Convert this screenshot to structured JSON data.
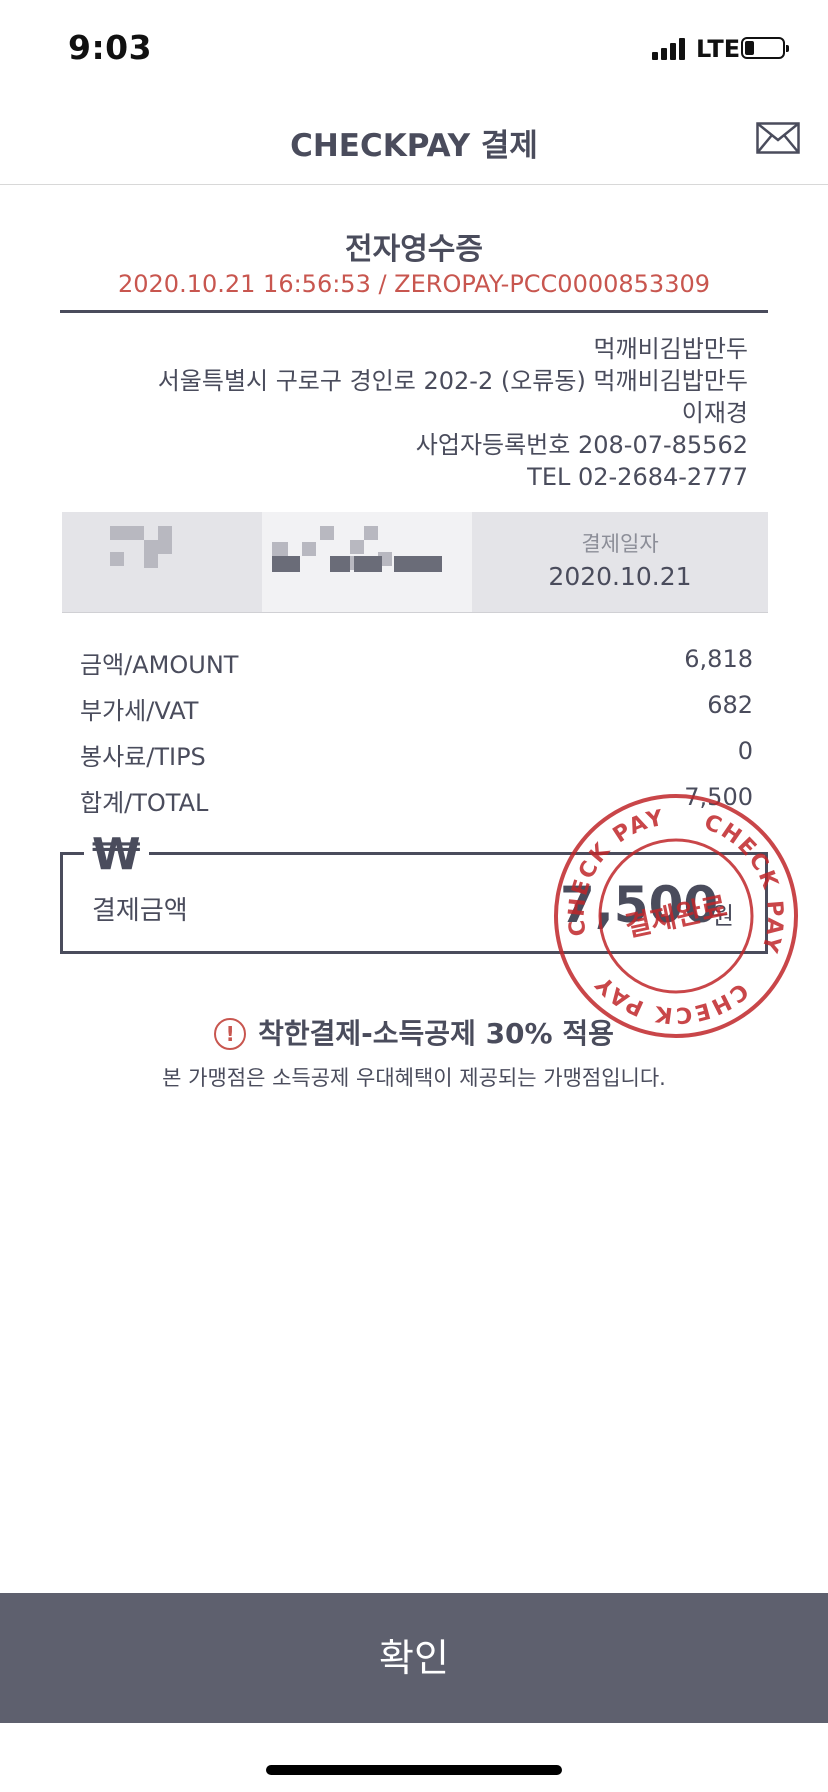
{
  "status_bar": {
    "time": "9:03",
    "network": "LTE",
    "battery_level": 0.25
  },
  "header": {
    "title": "CHECKPAY 결제",
    "mail_icon": "mail-icon"
  },
  "receipt": {
    "title": "전자영수증",
    "meta": "2020.10.21 16:56:53 / ZEROPAY-PCC0000853309"
  },
  "merchant": {
    "name": "먹깨비김밥만두",
    "address": "서울특별시 구로구 경인로 202-2 (오류동) 먹깨비김밥만두",
    "owner": "이재경",
    "business_no": "사업자등록번호 208-07-85562",
    "tel": "TEL 02-2684-2777"
  },
  "payment_date": {
    "label": "결제일자",
    "value": "2020.10.21"
  },
  "amounts": [
    {
      "label": "금액/AMOUNT",
      "value": "6,818"
    },
    {
      "label": "부가세/VAT",
      "value": "682"
    },
    {
      "label": "봉사료/TIPS",
      "value": "0"
    },
    {
      "label": "합계/TOTAL",
      "value": "7,500"
    }
  ],
  "total": {
    "symbol": "₩",
    "label": "결제금액",
    "amount": "7,500",
    "unit": "원"
  },
  "stamp": {
    "ring_text": "CHECK PAY",
    "center_text": "결제완료",
    "color": "#c0262a"
  },
  "notice": {
    "icon": "!",
    "title": "착한결제-소득공제 30% 적용",
    "desc": "본 가맹점은 소득공제 우대혜택이 제공되는 가맹점입니다."
  },
  "confirm_button": {
    "label": "확인"
  },
  "colors": {
    "primary_text": "#4a4c5c",
    "accent_red": "#c8564f",
    "button_bg": "#5e606e"
  }
}
